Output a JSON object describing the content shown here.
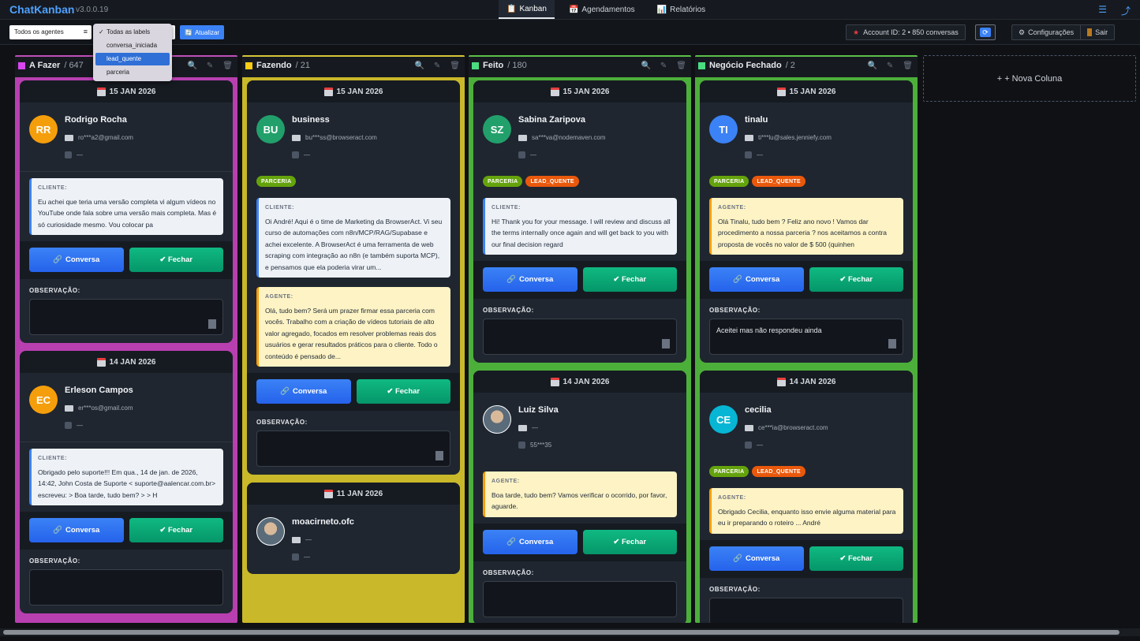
{
  "app": {
    "name": "ChatKanban",
    "version": "v3.0.0.19"
  },
  "nav": {
    "kanban": "Kanban",
    "agendamentos": "Agendamentos",
    "relatorios": "Relatórios"
  },
  "toolbar": {
    "agent_filter": "Todos os agentes",
    "refresh": "Atualizar",
    "account": "Account ID: 2 • 850 conversas",
    "config": "Configurações",
    "logout": "Sair"
  },
  "label_dropdown": {
    "options": [
      "Todas as labels",
      "conversa_iniciada",
      "lead_quente",
      "parceria"
    ],
    "selected": "Todas as labels",
    "highlighted": "lead_quente"
  },
  "new_column": "+ + Nova Coluna",
  "common": {
    "client_label": "CLIENTE:",
    "agent_label": "AGENTE:",
    "obs_label": "OBSERVAÇÃO:",
    "btn_conversa": "Conversa",
    "btn_fechar": "✔ Fechar"
  },
  "colors": {
    "a_fazer": "#b83fb0",
    "fazendo": "#c9b82a",
    "feito": "#4caf3a",
    "negocio_fechado": "#4caf3a"
  },
  "columns": [
    {
      "title": "A Fazer",
      "count": "/ 647",
      "cards": [
        {
          "date": "15 JAN 2026",
          "initials": "RR",
          "name": "Rodrigo Rocha",
          "email": "ro***a2@gmail.com",
          "phone": "—",
          "msg_type": "client",
          "message": "Eu achei que teria uma versão completa vi algum vídeos no YouTube onde fala sobre uma versão mais completa. Mas é só curiosidade mesmo. Vou colocar pa"
        },
        {
          "date": "14 JAN 2026",
          "initials": "EC",
          "name": "Erleson Campos",
          "email": "er***os@gmail.com",
          "phone": "—",
          "msg_type": "client",
          "message": "Obrigado pelo suporte!!! Em qua., 14 de jan. de 2026, 14:42, John Costa de Suporte < suporte@aalencar.com.br> escreveu: > Boa tarde, tudo bem? > > H"
        }
      ]
    },
    {
      "title": "Fazendo",
      "count": "/ 21",
      "cards": [
        {
          "date": "15 JAN 2026",
          "initials": "BU",
          "name": "business",
          "email": "bu***ss@browseract.com",
          "phone": "—",
          "tags": [
            "PARCERIA"
          ],
          "client_message": "Oi André! Aqui é o time de Marketing da BrowserAct. Vi seu curso de automações com n8n/MCP/RAG/Supabase e achei excelente. A BrowserAct é uma ferramenta de web scraping com integração ao n8n (e também suporta MCP), e pensamos que ela poderia virar um...",
          "agent_message": "Olá, tudo bem? Será um prazer firmar essa parceria com vocês. Trabalho com a criação de vídeos tutoriais de alto valor agregado, focados em resolver problemas reais dos usuários e gerar resultados práticos para o cliente. Todo o conteúdo é pensado de..."
        },
        {
          "date": "11 JAN 2026",
          "name": "moacirneto.ofc",
          "email": "—",
          "phone": "—"
        }
      ]
    },
    {
      "title": "Feito",
      "count": "/ 180",
      "cards": [
        {
          "date": "15 JAN 2026",
          "initials": "SZ",
          "name": "Sabina Zaripova",
          "email": "sa***va@nodemaven.com",
          "phone": "—",
          "tags": [
            "PARCERIA",
            "LEAD_QUENTE"
          ],
          "message": "Hi! Thank you for your message. I will review and discuss all the terms internally once again and will get back to you with our final decision regard"
        },
        {
          "date": "14 JAN 2026",
          "name": "Luiz Silva",
          "email": "—",
          "phone": "55***35",
          "message": "Boa tarde, tudo bem? Vamos verificar o ocorrido, por favor, aguarde."
        }
      ]
    },
    {
      "title": "Negócio Fechado",
      "count": "/ 2",
      "cards": [
        {
          "date": "15 JAN 2026",
          "initials": "TI",
          "name": "tinalu",
          "email": "ti***lu@sales.jenniefy.com",
          "phone": "—",
          "tags": [
            "PARCERIA",
            "LEAD_QUENTE"
          ],
          "message": "Olá Tinalu, tudo bem ? Feliz ano novo ! Vamos dar procedimento a nossa parceria ? nos aceitamos a contra proposta de vocês no valor de $ 500 (quinhen",
          "observation": "Aceitei mas não respondeu ainda"
        },
        {
          "date": "14 JAN 2026",
          "initials": "CE",
          "name": "cecilia",
          "email": "ce***ia@browseract.com",
          "phone": "—",
          "tags": [
            "PARCERIA",
            "LEAD_QUENTE"
          ],
          "message": "Obrigado Cecilia, enquanto isso envie alguma material para eu ir preparando o roteiro ... André"
        }
      ]
    }
  ]
}
